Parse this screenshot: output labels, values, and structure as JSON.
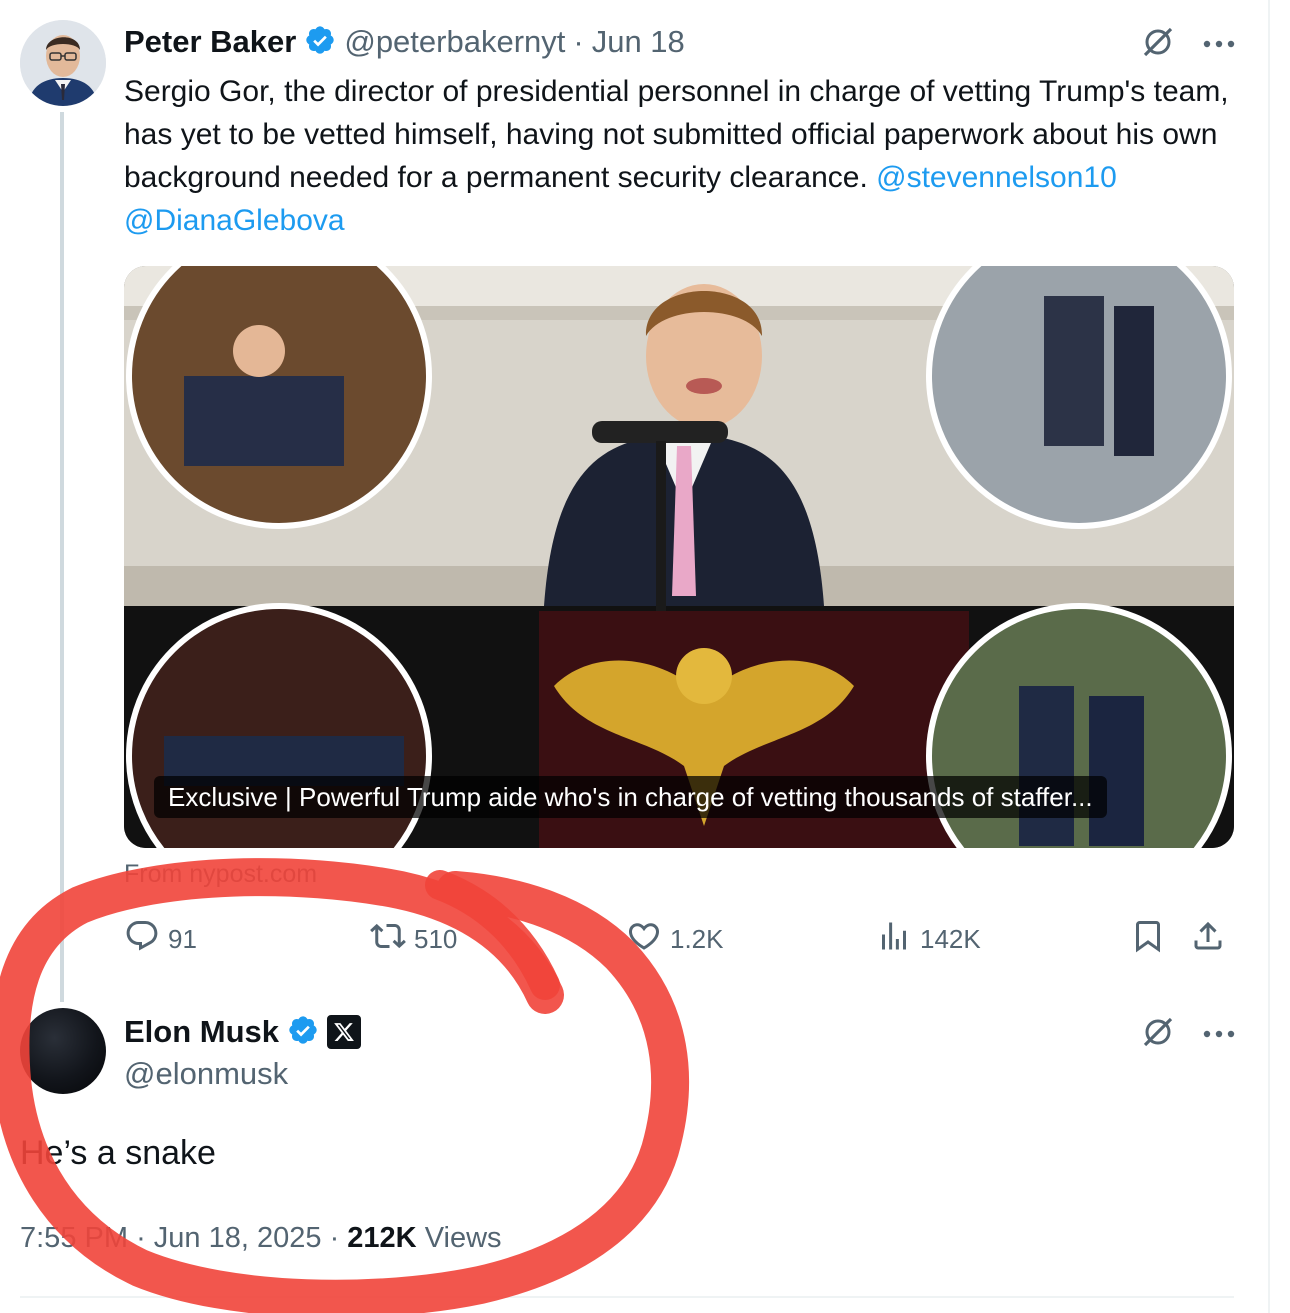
{
  "tweet": {
    "author_name": "Peter Baker",
    "author_handle": "@peterbakernyt",
    "separator": "·",
    "date": "Jun 18",
    "text": "Sergio Gor, the director of presidential personnel in charge of vetting Trump's team, has yet to be vetted himself, having not submitted official paperwork about his own background needed for a permanent security clearance.",
    "mentions": [
      "@stevennelson10",
      "@DianaGlebova"
    ],
    "card_caption": "Exclusive | Powerful Trump aide who's in charge of vetting thousands of staffer...",
    "card_source": "From nypost.com",
    "stats": {
      "replies": "91",
      "reposts": "510",
      "likes": "1.2K",
      "views": "142K"
    }
  },
  "reply": {
    "author_name": "Elon Musk",
    "author_handle": "@elonmusk",
    "affiliation_badge": "X",
    "text": "He’s a snake",
    "time": "7:55 PM",
    "separator": "·",
    "date": "Jun 18, 2025",
    "views_count": "212K",
    "views_label": "Views"
  },
  "icons": {
    "verified": "verified-badge-icon",
    "grok": "grok-icon",
    "more": "more-icon",
    "reply": "reply-icon",
    "repost": "repost-icon",
    "like": "like-icon",
    "views": "views-icon",
    "bookmark": "bookmark-icon",
    "share": "share-icon"
  },
  "colors": {
    "link": "#1d9bf0",
    "verified": "#1d9bf0",
    "secondary_text": "#536471",
    "primary_text": "#0f1419",
    "annotation_stroke": "#f1443a"
  }
}
